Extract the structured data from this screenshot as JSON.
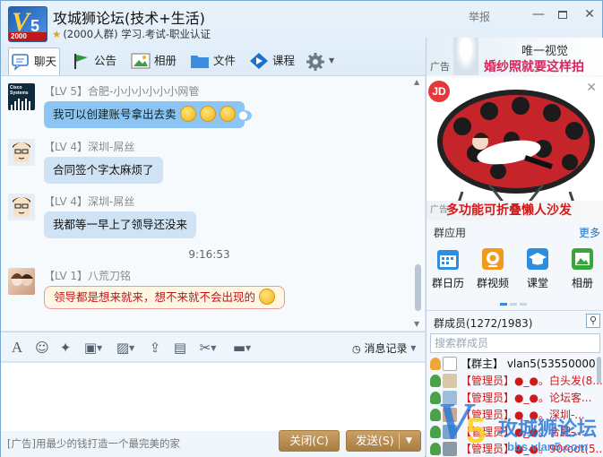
{
  "header": {
    "group_name": "攻城狮论坛(技术+生活)",
    "group_meta": "(2000人群) 学习.考试-职业认证",
    "report_label": "举报",
    "logo_year": "2000",
    "logo_v": "V",
    "logo_5": "5"
  },
  "window_controls": {
    "minimize": "—",
    "close": "✕"
  },
  "tabs": [
    {
      "label": "聊天"
    },
    {
      "label": "公告"
    },
    {
      "label": "相册"
    },
    {
      "label": "文件"
    },
    {
      "label": "课程"
    }
  ],
  "messages": [
    {
      "sender": "【LV 5】合肥-小小小小小小网管",
      "text": "我可以创建账号拿出去卖",
      "style": "blue",
      "avatar_label": "Cisco Systems"
    },
    {
      "sender": "【LV 4】深圳-屌丝",
      "text": "合同签个字太麻烦了",
      "style": "normal"
    },
    {
      "sender": "【LV 4】深圳-屌丝",
      "text": "我都等一早上了领导还没来",
      "style": "normal"
    },
    {
      "sender": "【LV 1】八荒刀铭",
      "text": "领导都是想来就来，想不来就不会出现的",
      "style": "special"
    }
  ],
  "time_divider": "9:16:53",
  "toolbar": {
    "message_record": "消息记录"
  },
  "bottom": {
    "ad_text": "[广告]用最少的钱打造一个最完美的家",
    "close_button": "关闭(C)",
    "send_button": "发送(S)"
  },
  "right_panel": {
    "banner_ad": {
      "ad_tag": "广告",
      "line1": "唯一视觉",
      "line2": "婚纱照就要这样拍"
    },
    "product_ad": {
      "badge": "JD",
      "ad_tag": "广告",
      "caption": "多功能可折叠懒人沙发"
    },
    "apps": {
      "title": "群应用",
      "more": "更多",
      "items": [
        {
          "label": "群日历",
          "icon": "calendar-icon",
          "color": "#2d8ee0"
        },
        {
          "label": "群视频",
          "icon": "video-icon",
          "color": "#f19a1b"
        },
        {
          "label": "课堂",
          "icon": "graduation-cap-icon",
          "color": "#2d8ee0"
        },
        {
          "label": "相册",
          "icon": "photo-icon",
          "color": "#3aa53a"
        }
      ]
    },
    "members": {
      "title": "群成员(1272/1983)",
      "search_placeholder": "搜索群成员",
      "list": [
        {
          "role": "owner",
          "text": "【群主】 vlan5(53550000)"
        },
        {
          "role": "admin",
          "text": "【管理员】●_●。白头发(8..."
        },
        {
          "role": "admin",
          "text": "【管理员】●_●。论坛客..."
        },
        {
          "role": "admin",
          "text": "【管理员】●_●。深圳-..."
        },
        {
          "role": "admin",
          "text": "【管理员】●_●。合肥-..."
        },
        {
          "role": "admin",
          "text": "【管理员】●_●。90root(5..."
        }
      ]
    }
  },
  "watermark": {
    "v": "V",
    "five": "5",
    "title": "攻城狮论坛",
    "url": "bbs.vlan5.com"
  },
  "colors": {
    "accent_blue": "#1d6fc4",
    "admin_red": "#d01818",
    "button_gold": "#b88c4f",
    "chat_bubble": "#cfe3f5",
    "chat_bubble_blue": "#8cc5f3"
  }
}
